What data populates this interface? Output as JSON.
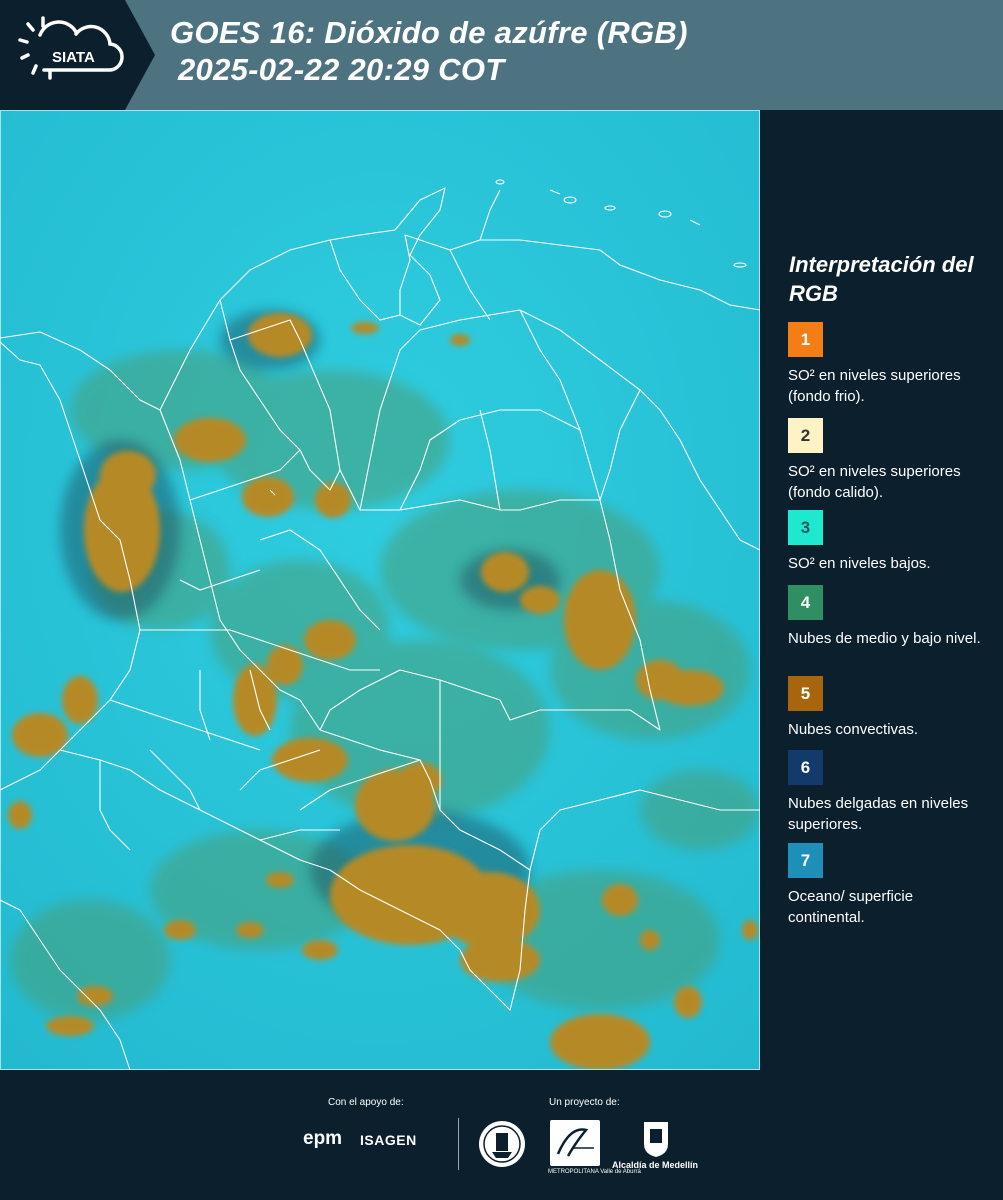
{
  "header": {
    "logo_text": "SIATA",
    "title_line1": "GOES 16: Dióxido de azúfre (RGB)",
    "title_line2": "2025-02-22 20:29 COT"
  },
  "map": {
    "background_color": "#29c6db",
    "border_color": "#ffffff",
    "cloud_color": "#b58a26"
  },
  "legend": {
    "title": "Interpretación del RGB",
    "items": [
      {
        "number": "1",
        "color": "#f47d16",
        "text": "SO² en niveles superiores (fondo frio)."
      },
      {
        "number": "2",
        "color": "#fdf3c4",
        "text": "SO² en niveles superiores (fondo calido)."
      },
      {
        "number": "3",
        "color": "#1ee8cf",
        "text": "SO² en niveles bajos."
      },
      {
        "number": "4",
        "color": "#2f8f62",
        "text": "Nubes de medio y bajo nivel."
      },
      {
        "number": "5",
        "color": "#a8650d",
        "text": "Nubes convectivas."
      },
      {
        "number": "6",
        "color": "#123a6b",
        "text": "Nubes delgadas en niveles superiores."
      },
      {
        "number": "7",
        "color": "#1d8fb8",
        "text": "Oceano/ superficie continental."
      }
    ]
  },
  "footer": {
    "support_label": "Con el apoyo de:",
    "project_label": "Un proyecto de:",
    "epm": "epm",
    "isagen": "ISAGEN",
    "area_sub": "METROPOLITANA Valle de Aburrá",
    "alcaldia": "Alcaldía de Medellín"
  }
}
